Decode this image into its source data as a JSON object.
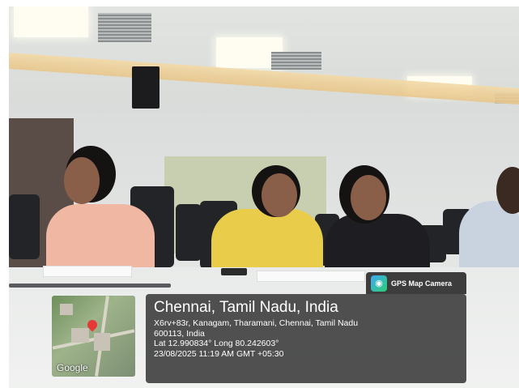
{
  "gps_overlay": {
    "app_label": "GPS Map Camera",
    "city": "Chennai, Tamil Nadu, India",
    "address_line1": "X6rv+83r, Kanagam, Tharamani, Chennai, Tamil Nadu",
    "address_line2": "600113, India",
    "coordinates": "Lat 12.990834° Long 80.242603°",
    "datetime": "23/08/2025 11:19 AM GMT +05:30",
    "map_attribution": "Google"
  }
}
